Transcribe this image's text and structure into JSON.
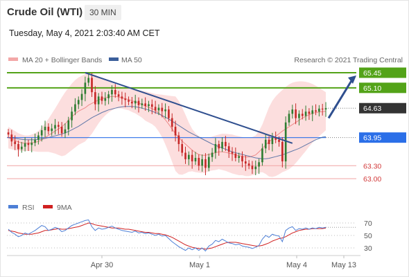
{
  "header": {
    "instrument": "Crude Oil (WTI)",
    "timeframe": "30 MIN",
    "datetime": "Tuesday, May 4, 2021 2:03:40 AM CET",
    "legend_ma20": "MA 20 + Bollinger Bands",
    "legend_ma50": "MA 50",
    "copyright": "Research © 2021 Trading Central",
    "legend_rsi": "RSI",
    "legend_9ma": "9MA"
  },
  "colors": {
    "up_candle": "#2e7d32",
    "down_candle": "#c62828",
    "bollinger_fill": "#fbd3d3",
    "ma20": "#ef8a8a",
    "ma50": "#3b5f9b",
    "trendline": "#2f4f8f",
    "green_level": "#53a318",
    "blue_level": "#2b6fe8",
    "red_level": "#f0a3a3",
    "current_price_bg": "#333333",
    "rsi_line": "#4d7fd6",
    "rsi_9ma": "#d02020"
  },
  "chart_data": [
    {
      "type": "candlestick",
      "title": "Crude Oil (WTI)",
      "timeframe": "30 MIN",
      "ylim": [
        62.7,
        65.55
      ],
      "x_labels": [
        "Apr 30",
        "May 1",
        "May 4",
        "May 13"
      ],
      "levels": [
        {
          "label": "65.45",
          "value": 65.45,
          "kind": "resistance"
        },
        {
          "label": "65.10",
          "value": 65.1,
          "kind": "resistance"
        },
        {
          "label": "64.63",
          "value": 64.63,
          "kind": "current"
        },
        {
          "label": "63.95",
          "value": 63.95,
          "kind": "pivot"
        },
        {
          "label": "63.30",
          "value": 63.3,
          "kind": "support"
        },
        {
          "label": "63.00",
          "value": 63.0,
          "kind": "support"
        }
      ],
      "closes": [
        64.02,
        63.86,
        63.8,
        63.68,
        63.74,
        63.82,
        63.78,
        63.83,
        63.9,
        64.0,
        64.12,
        64.2,
        64.1,
        64.16,
        64.24,
        64.2,
        64.05,
        64.14,
        64.35,
        64.55,
        64.72,
        64.82,
        64.96,
        65.22,
        65.33,
        65.0,
        64.72,
        64.9,
        64.8,
        64.86,
        64.95,
        65.05,
        64.95,
        64.9,
        64.85,
        64.82,
        64.78,
        64.74,
        64.8,
        64.7,
        64.74,
        64.68,
        64.72,
        64.66,
        64.58,
        64.64,
        64.56,
        64.6,
        64.4,
        64.2,
        64.0,
        63.8,
        63.6,
        63.45,
        63.55,
        63.4,
        63.48,
        63.3,
        63.45,
        63.25,
        63.5,
        63.6,
        63.8,
        63.7,
        63.85,
        63.75,
        63.62,
        63.58,
        63.48,
        63.52,
        63.4,
        63.35,
        63.3,
        63.22,
        63.28,
        63.38,
        63.7,
        63.9,
        63.8,
        63.95,
        63.9,
        63.85,
        63.4,
        64.3,
        64.5,
        64.6,
        64.4,
        64.5,
        64.45,
        64.55,
        64.5,
        64.58,
        64.55,
        64.62,
        64.6,
        64.63
      ],
      "ma20": [
        63.95,
        63.92,
        63.88,
        63.85,
        63.83,
        63.82,
        63.82,
        63.83,
        63.84,
        63.86,
        63.9,
        63.95,
        64.0,
        64.05,
        64.1,
        64.15,
        64.2,
        64.27,
        64.35,
        64.43,
        64.5,
        64.56,
        64.6,
        64.64,
        64.7,
        64.74,
        64.78,
        64.82,
        64.85,
        64.87,
        64.89,
        64.9,
        64.9,
        64.89,
        64.87,
        64.85,
        64.83,
        64.8,
        64.78,
        64.75,
        64.72,
        64.68,
        64.65,
        64.62,
        64.58,
        64.52,
        64.45,
        64.36,
        64.26,
        64.15,
        64.04,
        63.95,
        63.87,
        63.8,
        63.73,
        63.66,
        63.6,
        63.56,
        63.54,
        63.54,
        63.56,
        63.58,
        63.6,
        63.62,
        63.62,
        63.61,
        63.59,
        63.57,
        63.55,
        63.53,
        63.52,
        63.5,
        63.5,
        63.52,
        63.55,
        63.62,
        63.7,
        63.78,
        63.85,
        63.92,
        63.98,
        64.04,
        64.1,
        64.15,
        64.2,
        64.25,
        64.3,
        64.35,
        64.4,
        64.44,
        64.48,
        64.51,
        64.53,
        64.54,
        64.55,
        64.56
      ],
      "bb_upper": [
        64.2,
        64.15,
        64.1,
        64.05,
        64.02,
        64.0,
        64.0,
        64.02,
        64.05,
        64.1,
        64.18,
        64.28,
        64.38,
        64.5,
        64.62,
        64.75,
        64.88,
        65.0,
        65.1,
        65.2,
        65.28,
        65.34,
        65.38,
        65.42,
        65.45,
        65.44,
        65.4,
        65.36,
        65.32,
        65.28,
        65.25,
        65.22,
        65.18,
        65.15,
        65.12,
        65.1,
        65.08,
        65.06,
        65.05,
        65.04,
        65.03,
        65.02,
        65.0,
        64.98,
        64.96,
        64.95,
        64.94,
        64.93,
        64.92,
        64.91,
        64.9,
        64.8,
        64.65,
        64.48,
        64.3,
        64.15,
        64.05,
        63.98,
        63.95,
        63.94,
        63.95,
        63.97,
        64.0,
        64.02,
        64.04,
        64.04,
        64.03,
        64.02,
        64.0,
        63.98,
        63.96,
        63.94,
        63.94,
        63.96,
        64.0,
        64.1,
        64.25,
        64.45,
        64.65,
        64.8,
        64.9,
        64.98,
        65.05,
        65.12,
        65.18,
        65.22,
        65.24,
        65.25,
        65.25,
        65.24,
        65.22,
        65.19,
        65.15,
        65.1,
        65.05,
        65.0
      ],
      "bb_lower": [
        63.7,
        63.68,
        63.66,
        63.65,
        63.64,
        63.64,
        63.64,
        63.64,
        63.63,
        63.62,
        63.62,
        63.62,
        63.62,
        63.6,
        63.58,
        63.55,
        63.52,
        63.54,
        63.6,
        63.66,
        63.72,
        63.78,
        63.82,
        63.86,
        63.95,
        64.04,
        64.16,
        64.28,
        64.38,
        64.46,
        64.53,
        64.58,
        64.62,
        64.63,
        64.62,
        64.6,
        64.58,
        64.54,
        64.51,
        64.46,
        64.41,
        64.34,
        64.3,
        64.26,
        64.2,
        64.09,
        63.96,
        63.79,
        63.6,
        63.39,
        63.18,
        63.1,
        63.09,
        63.12,
        63.16,
        63.17,
        63.15,
        63.14,
        63.13,
        63.14,
        63.17,
        63.19,
        63.2,
        63.22,
        63.2,
        63.18,
        63.15,
        63.12,
        63.1,
        63.08,
        63.08,
        63.06,
        63.06,
        63.08,
        63.1,
        63.14,
        63.15,
        63.11,
        63.05,
        63.04,
        63.06,
        63.1,
        63.15,
        63.18,
        63.22,
        63.28,
        63.36,
        63.45,
        63.55,
        63.64,
        63.74,
        63.83,
        63.91,
        63.98,
        64.05,
        64.12
      ],
      "ma50": [
        63.95,
        63.94,
        63.93,
        63.92,
        63.91,
        63.9,
        63.9,
        63.9,
        63.9,
        63.91,
        63.92,
        63.93,
        63.95,
        63.97,
        63.99,
        64.01,
        64.03,
        64.06,
        64.09,
        64.13,
        64.17,
        64.21,
        64.26,
        64.31,
        64.36,
        64.41,
        64.45,
        64.49,
        64.53,
        64.56,
        64.59,
        64.61,
        64.63,
        64.65,
        64.66,
        64.67,
        64.67,
        64.67,
        64.66,
        64.65,
        64.63,
        64.61,
        64.59,
        64.56,
        64.53,
        64.5,
        64.46,
        64.42,
        64.38,
        64.33,
        64.28,
        64.23,
        64.18,
        64.13,
        64.08,
        64.04,
        64.0,
        63.96,
        63.92,
        63.88,
        63.84,
        63.8,
        63.77,
        63.74,
        63.71,
        63.68,
        63.65,
        63.62,
        63.6,
        63.58,
        63.56,
        63.54,
        63.52,
        63.5,
        63.48,
        63.47,
        63.46,
        63.46,
        63.47,
        63.49,
        63.51,
        63.53,
        63.55,
        63.58,
        63.61,
        63.64,
        63.67,
        63.7,
        63.74,
        63.78,
        63.82,
        63.86,
        63.9,
        63.93,
        63.96,
        63.97
      ]
    },
    {
      "type": "line",
      "title": "RSI",
      "ylim": [
        20,
        80
      ],
      "y_ticks": [
        70,
        50,
        30
      ],
      "series": [
        {
          "name": "RSI",
          "values": [
            60,
            55,
            52,
            48,
            50,
            54,
            52,
            55,
            58,
            62,
            66,
            64,
            58,
            60,
            63,
            61,
            56,
            58,
            62,
            66,
            68,
            70,
            72,
            74,
            75,
            64,
            58,
            62,
            60,
            61,
            63,
            65,
            62,
            60,
            58,
            57,
            56,
            55,
            57,
            54,
            55,
            53,
            54,
            52,
            50,
            52,
            49,
            50,
            45,
            40,
            36,
            32,
            29,
            26,
            30,
            27,
            30,
            26,
            30,
            25,
            33,
            36,
            42,
            40,
            44,
            41,
            38,
            37,
            35,
            36,
            33,
            32,
            31,
            29,
            31,
            34,
            44,
            50,
            47,
            52,
            50,
            49,
            40,
            58,
            62,
            64,
            58,
            61,
            60,
            62,
            60,
            62,
            61,
            63,
            62,
            63
          ]
        },
        {
          "name": "9MA",
          "values": [
            58,
            57,
            56,
            54,
            53,
            52,
            52,
            52,
            53,
            54,
            56,
            58,
            58,
            59,
            60,
            61,
            60,
            60,
            61,
            62,
            63,
            64,
            66,
            68,
            70,
            69,
            67,
            66,
            65,
            64,
            63,
            62,
            62,
            62,
            61,
            60,
            60,
            59,
            58,
            57,
            56,
            55,
            55,
            54,
            53,
            53,
            52,
            51,
            49,
            47,
            44,
            41,
            38,
            35,
            33,
            31,
            30,
            29,
            29,
            28,
            29,
            30,
            32,
            34,
            36,
            38,
            39,
            39,
            39,
            38,
            37,
            36,
            35,
            34,
            33,
            33,
            34,
            36,
            38,
            41,
            43,
            45,
            46,
            48,
            51,
            54,
            56,
            58,
            59,
            60,
            60,
            61,
            61,
            61,
            61,
            62
          ]
        }
      ]
    }
  ]
}
